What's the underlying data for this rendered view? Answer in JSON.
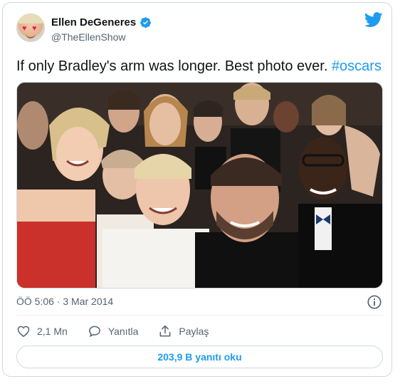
{
  "author": {
    "name": "Ellen DeGeneres",
    "handle": "@TheEllenShow",
    "verified": true,
    "avatar_icon": "ellen-heart-eyes-avatar"
  },
  "tweet": {
    "text": "If only Bradley's arm was longer. Best photo ever. ",
    "hashtag": "#oscars",
    "image_description_icon": "oscars-group-selfie-photo",
    "timestamp": "ÖÖ 5:06 · 3 Mar 2014"
  },
  "actions": {
    "likes_count": "2,1 Mn",
    "reply_label": "Yanıtla",
    "share_label": "Paylaş"
  },
  "read_replies_label": "203,9 B yanıtı oku",
  "colors": {
    "accent": "#1d9bf0",
    "muted": "#536471",
    "text": "#0f1419",
    "border": "#cfd9de"
  }
}
